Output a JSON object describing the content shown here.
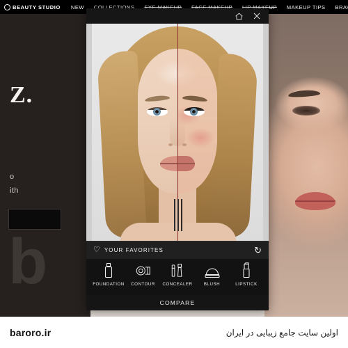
{
  "topnav": {
    "brand": "BEAUTY STUDIO",
    "items": [
      {
        "label": "NEW",
        "strike": false
      },
      {
        "label": "COLLECTIONS",
        "strike": false
      },
      {
        "label": "EYE MAKEUP",
        "strike": true
      },
      {
        "label": "FACE MAKEUP",
        "strike": true
      },
      {
        "label": "LIP MAKEUP",
        "strike": true
      },
      {
        "label": "MAKEUP TIPS",
        "strike": false
      },
      {
        "label": "BRAVE TOGET",
        "strike": false
      }
    ]
  },
  "background": {
    "headline": "Z.",
    "line1": "o",
    "line2": "ith",
    "watermark": "b"
  },
  "modal": {
    "header": {
      "home_icon": "home-icon",
      "close_icon": "close-icon"
    },
    "favorites": {
      "heart_icon": "heart-icon",
      "label": "YOUR FAVORITES",
      "refresh_icon": "refresh-icon"
    },
    "tools": [
      {
        "label": "FOUNDATION",
        "icon": "foundation-bottle-icon"
      },
      {
        "label": "CONTOUR",
        "icon": "contour-palette-icon"
      },
      {
        "label": "CONCEALER",
        "icon": "concealer-tube-icon"
      },
      {
        "label": "BLUSH",
        "icon": "blush-compact-icon"
      },
      {
        "label": "LIPSTICK",
        "icon": "lipstick-icon"
      }
    ],
    "compare_label": "COMPARE"
  },
  "footer": {
    "site": "baroro.ir",
    "tagline": "اولین سایت جامع زیبایی در ایران"
  },
  "colors": {
    "nav_bg": "#000000",
    "modal_bg": "#1b1b1b",
    "divider": "#8b2f2f",
    "footer_bg": "#ffffff"
  }
}
